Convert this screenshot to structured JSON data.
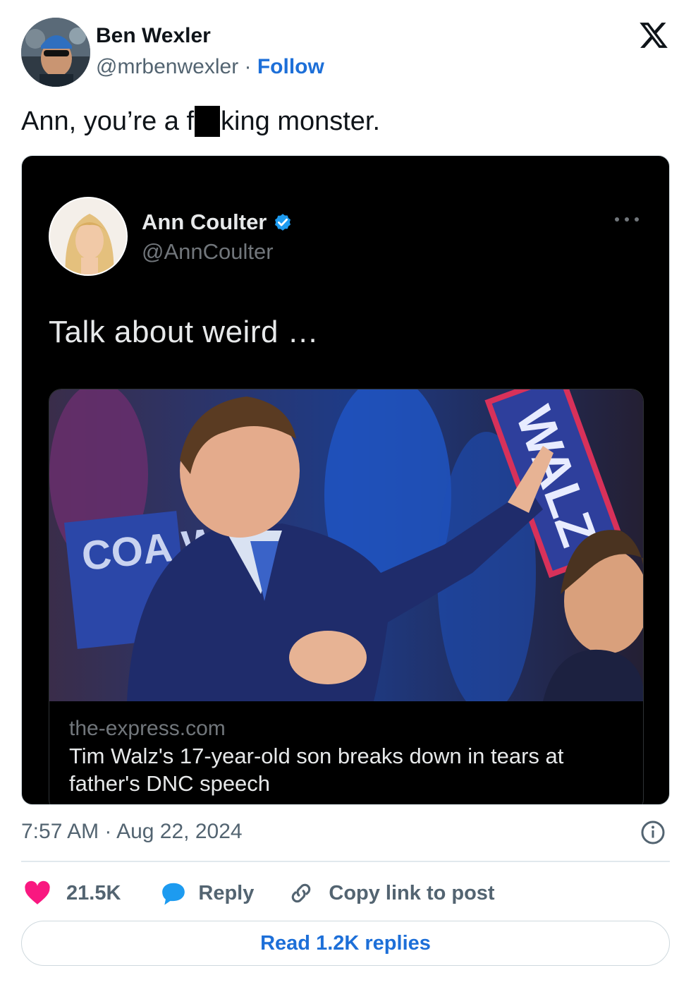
{
  "author": {
    "name": "Ben Wexler",
    "handle": "@mrbenwexler",
    "separator": " · ",
    "follow_label": "Follow"
  },
  "tweet": {
    "text_before": "Ann, you’re a f",
    "text_after": "king monster."
  },
  "embedded_post": {
    "name": "Ann Coulter",
    "handle": "@AnnCoulter",
    "text": "Talk about weird …",
    "card": {
      "domain": "the-express.com",
      "title": "Tim Walz's 17-year-old son breaks down in tears at father's DNC speech",
      "sign_text_left": "COA W",
      "sign_text_right": "WALZ"
    }
  },
  "meta": {
    "timestamp": "7:57 AM · Aug 22, 2024"
  },
  "actions": {
    "like_count": "21.5K",
    "reply_label": "Reply",
    "copy_label": "Copy link to post"
  },
  "read_replies_label": "Read 1.2K replies",
  "colors": {
    "accent": "#1d6fd8",
    "like": "#f91880",
    "reply_icon": "#1d9bf0",
    "verified": "#1d9bf0"
  },
  "icons": {
    "logo": "x-logo-icon",
    "verified": "verified-badge-icon",
    "more": "more-dots-icon",
    "info": "info-icon",
    "like": "heart-icon",
    "reply": "speech-bubble-icon",
    "copy": "link-icon"
  }
}
